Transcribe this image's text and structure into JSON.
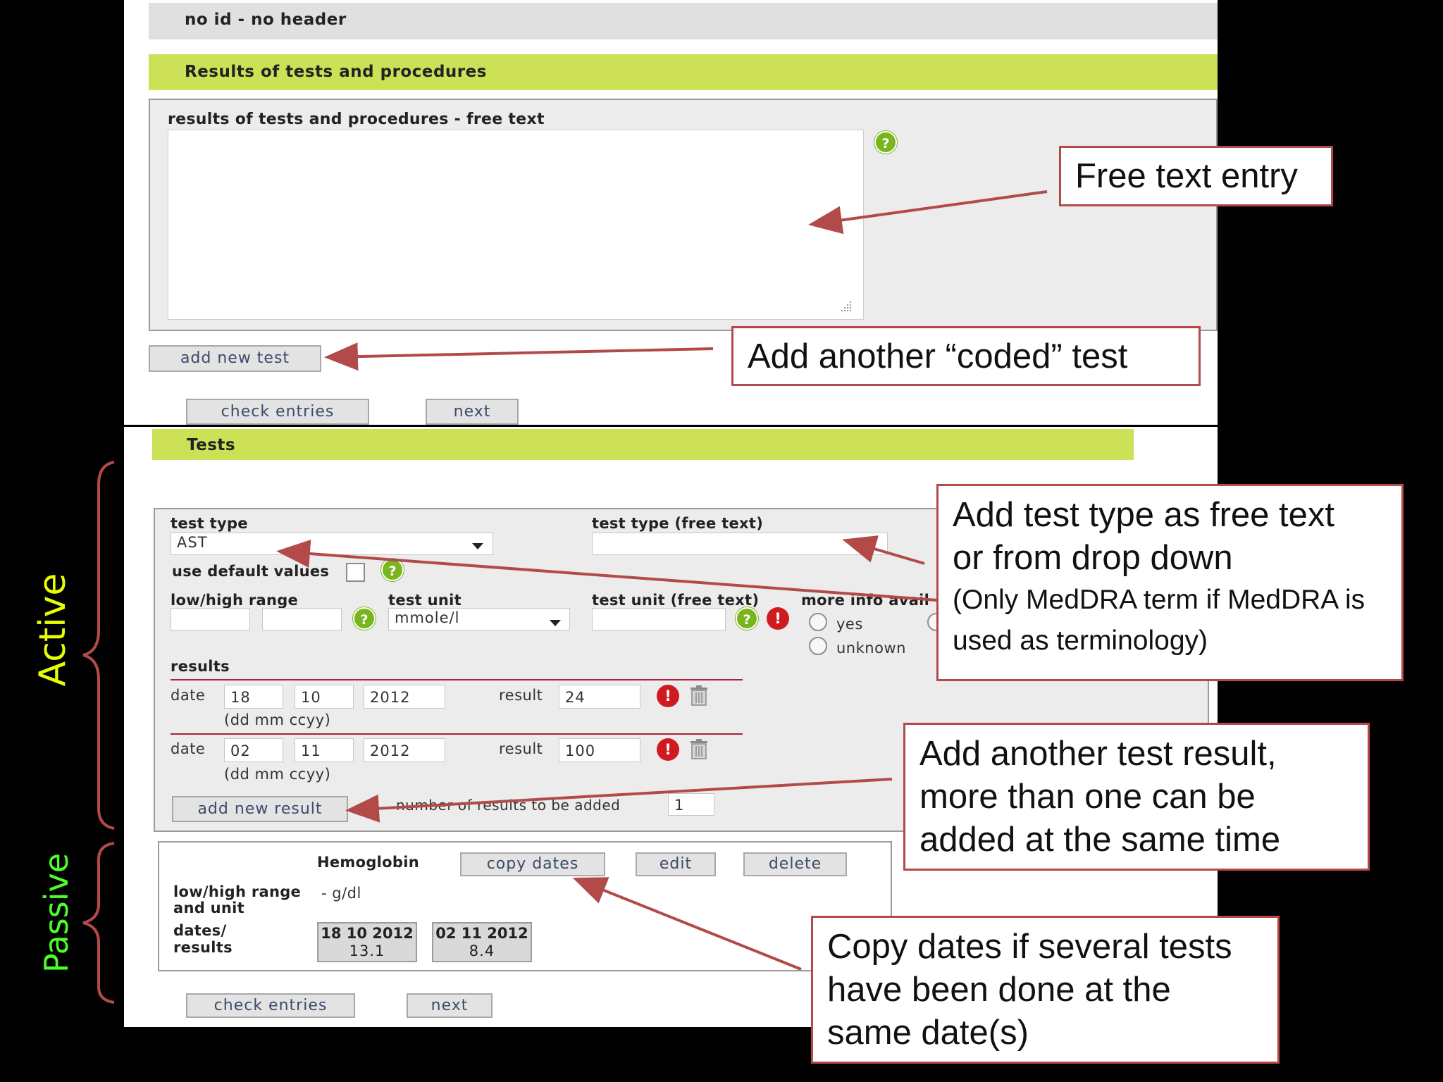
{
  "top": {
    "header_bar": "no id - no header",
    "section_title": "Results of tests and procedures",
    "free_text_label": "results of tests and procedures - free text",
    "add_new_test": "add new test",
    "check_entries": "check entries",
    "next": "next"
  },
  "tests": {
    "section_title": "Tests",
    "test_type_label": "test type",
    "test_type_value": "AST",
    "test_type_free_label": "test type (free text)",
    "use_default_values": "use default values",
    "low_high_label": "low/high range",
    "test_unit_label": "test unit",
    "test_unit_value": "mmole/l",
    "test_unit_free_label": "test unit (free text)",
    "more_info_label": "more info avail",
    "radio_yes": "yes",
    "radio_unknown": "unknown",
    "results_label": "results",
    "date_label": "date",
    "date_format": "(dd mm ccyy)",
    "result_label": "result",
    "rows": [
      {
        "dd": "18",
        "mm": "10",
        "yyyy": "2012",
        "result": "24"
      },
      {
        "dd": "02",
        "mm": "11",
        "yyyy": "2012",
        "result": "100"
      }
    ],
    "add_new_result": "add new result",
    "number_label": "number of results to be added",
    "number_value": "1"
  },
  "passive": {
    "test_name": "Hemoglobin",
    "copy_dates": "copy dates",
    "edit": "edit",
    "delete": "delete",
    "range_label_1": "low/high range",
    "range_label_2": "and unit",
    "range_value": "- g/dl",
    "dates_label_1": "dates/",
    "dates_label_2": "results",
    "entries": [
      {
        "date": "18 10 2012",
        "value": "13.1"
      },
      {
        "date": "02 11 2012",
        "value": "8.4"
      }
    ],
    "check_entries": "check entries",
    "next": "next"
  },
  "callouts": {
    "free_text": "Free text entry",
    "add_coded": "Add another “coded” test",
    "test_type_l1": "Add test type as free text",
    "test_type_l2": "or from drop down",
    "test_type_l3": "(Only MedDRA term if MedDRA is",
    "test_type_l4": "used as terminology)",
    "add_result_l1": "Add another test result,",
    "add_result_l2": "more than one can be",
    "add_result_l3": "added at the same time",
    "copy_l1": "Copy dates if several tests",
    "copy_l2": "have been done at the",
    "copy_l3": "same date(s)"
  },
  "side_labels": {
    "active": "Active",
    "passive": "Passive"
  },
  "colors": {
    "green_bar": "#cde156",
    "callout_border": "#b34a4a",
    "side_active": "#e6ff00",
    "side_passive": "#4cff2a"
  }
}
